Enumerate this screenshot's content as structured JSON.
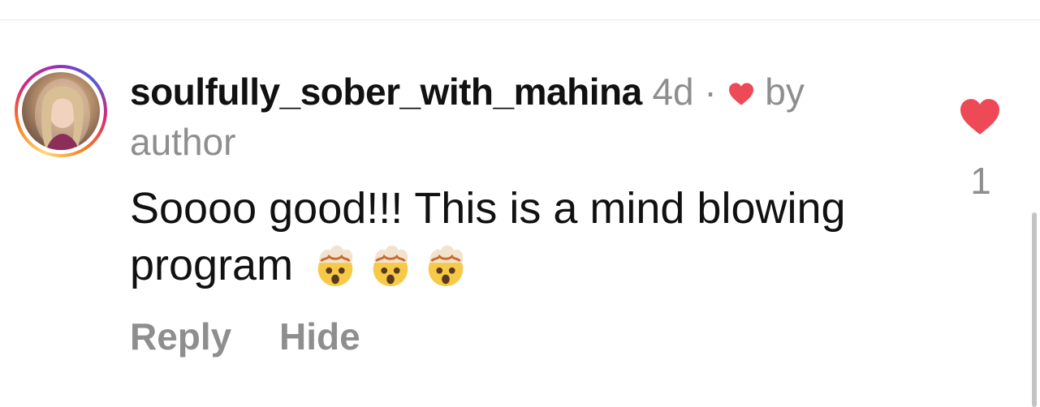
{
  "comment": {
    "username": "soulfully_sober_with_mahina",
    "time_ago": "4d",
    "separator": "·",
    "liked_by_label": "by",
    "liked_by_who": "author",
    "text": "Soooo good!!! This is a mind blowing program",
    "emojis": [
      "exploding-head",
      "exploding-head",
      "exploding-head"
    ],
    "like_count": "1"
  },
  "actions": {
    "reply_label": "Reply",
    "hide_label": "Hide"
  },
  "colors": {
    "heart_red": "#ed4956",
    "muted_gray": "#8e8e8e",
    "text_black": "#111111"
  },
  "icons": {
    "meta_heart": "heart-icon",
    "like_heart": "heart-filled-icon",
    "emoji": "exploding-head-emoji"
  }
}
